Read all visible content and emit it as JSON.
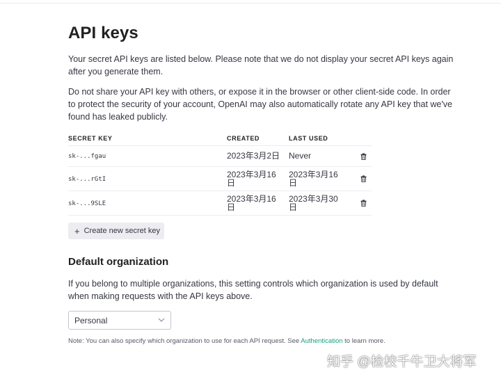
{
  "page": {
    "title": "API keys",
    "intro": "Your secret API keys are listed below. Please note that we do not display your secret API keys again after you generate them.",
    "warning": "Do not share your API key with others, or expose it in the browser or other client-side code. In order to protect the security of your account, OpenAI may also automatically rotate any API key that we've found has leaked publicly."
  },
  "table": {
    "headers": {
      "key": "SECRET KEY",
      "created": "CREATED",
      "last_used": "LAST USED"
    },
    "rows": [
      {
        "key": "sk-...fgau",
        "created": "2023年3月2日",
        "last_used": "Never"
      },
      {
        "key": "sk-...rGtI",
        "created": "2023年3月16日",
        "last_used": "2023年3月16日"
      },
      {
        "key": "sk-...9SLE",
        "created": "2023年3月16日",
        "last_used": "2023年3月30日"
      }
    ],
    "delete_icon": "trash-icon"
  },
  "create_button": {
    "icon": "+",
    "label": "Create new secret key"
  },
  "org": {
    "heading": "Default organization",
    "description": "If you belong to multiple organizations, this setting controls which organization is used by default when making requests with the API keys above.",
    "selected": "Personal",
    "note_prefix": "Note: You can also specify which organization to use for each API request. See ",
    "note_link": "Authentication",
    "note_suffix": " to learn more."
  },
  "watermark": "知乎 @检校千牛卫大将军",
  "colors": {
    "link": "#10a37f",
    "button_bg": "#ececf1",
    "border": "#ececf1",
    "text": "#353740"
  }
}
